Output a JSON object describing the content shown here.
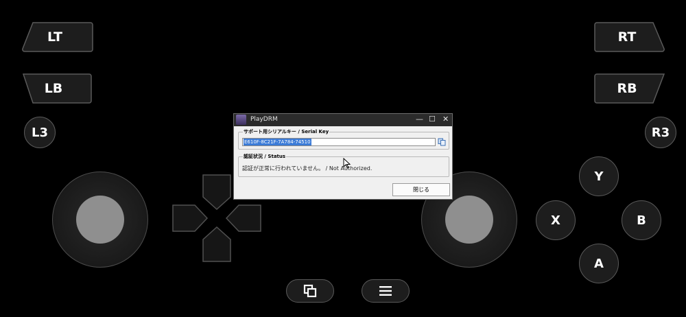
{
  "controller": {
    "lt": "LT",
    "rt": "RT",
    "lb": "LB",
    "rb": "RB",
    "l3": "L3",
    "r3": "R3",
    "y": "Y",
    "x": "X",
    "b": "B",
    "a": "A"
  },
  "dialog": {
    "title": "PlayDRM",
    "minimize": "—",
    "maximize": "☐",
    "close": "✕",
    "serial_group_label": "サポート用シリアルキー / Serial Key",
    "serial_value": "E610F-8C21F-7A784-74510",
    "status_group_label": "認証状況 / Status",
    "status_text": "認証が正常に行われていません。 / Not Authorized.",
    "close_button_label": "閉じる"
  },
  "icons": {
    "copy": "copy-icon",
    "windows": "overlapping-squares-icon",
    "menu": "hamburger-menu-icon",
    "app": "app-avatar-icon"
  }
}
